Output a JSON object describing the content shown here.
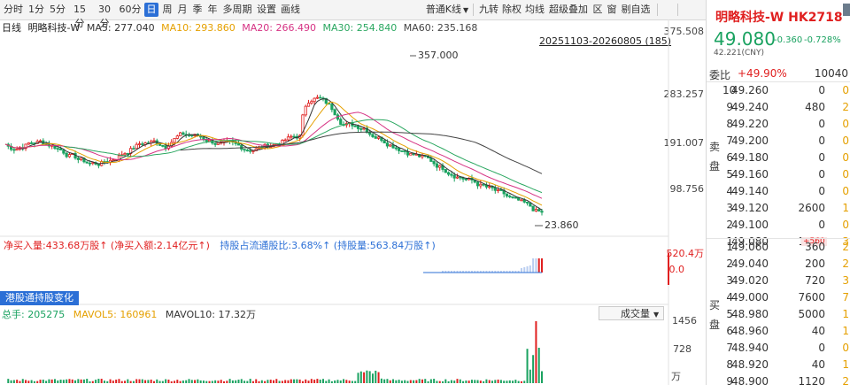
{
  "toolbar": {
    "left_buttons": [
      "分时",
      "1分",
      "5分",
      "15分",
      "30分",
      "60分",
      "日",
      "周",
      "月",
      "季",
      "年",
      "多周期",
      "设置",
      "画线"
    ],
    "active": "日",
    "right_buttons": [
      "普通K线",
      "九转",
      "除权",
      "均线",
      "超级叠加",
      "区",
      "窗",
      "剔自选"
    ]
  },
  "legend": {
    "prefix": "日线",
    "name": "明略科技-W",
    "ma5": "MA5: 277.040",
    "ma10": "MA10: 293.860",
    "ma20": "MA20: 266.490",
    "ma30": "MA30: 254.840",
    "ma60": "MA60: 235.168"
  },
  "range": "20251103-20260805 (185)",
  "price_axis": [
    "375.508",
    "283.257",
    "191.007",
    "98.756"
  ],
  "annotations": {
    "high": "357.000",
    "low": "23.860"
  },
  "flow": {
    "net_buy": "净买入量:433.68万股↑",
    "net_buy_amt": "(净买入额:2.14亿元↑)",
    "hold_ratio": "持股占流通股比:3.68%↑",
    "hold_qty": "(持股量:563.84万股↑)",
    "axis_top": "520.4万",
    "axis_zero": "0.0"
  },
  "tag_button": "港股通持股变化",
  "volume": {
    "total": "总手: 205275",
    "mavol5": "MAVOL5: 160961",
    "mavol10": "MAVOL10: 17.32万",
    "select": "成交量",
    "axis": [
      "1456",
      "728",
      "万"
    ]
  },
  "side": {
    "name": "明略科技-W HK2718",
    "price": "49.080",
    "change": "-0.360",
    "change_pct": "-0.728%",
    "cny": "42.221(CNY)",
    "ratio_label": "委比",
    "ratio_value": "+49.90%",
    "ratio_vol": "10040",
    "sell_label": "卖盘",
    "buy_label": "买盘",
    "asks": [
      {
        "lvl": "10",
        "price": "49.260",
        "vol": "0",
        "cnt": "0"
      },
      {
        "lvl": "9",
        "price": "49.240",
        "vol": "480",
        "cnt": "2"
      },
      {
        "lvl": "8",
        "price": "49.220",
        "vol": "0",
        "cnt": "0"
      },
      {
        "lvl": "7",
        "price": "49.200",
        "vol": "0",
        "cnt": "0"
      },
      {
        "lvl": "6",
        "price": "49.180",
        "vol": "0",
        "cnt": "0"
      },
      {
        "lvl": "5",
        "price": "49.160",
        "vol": "0",
        "cnt": "0"
      },
      {
        "lvl": "4",
        "price": "49.140",
        "vol": "0",
        "cnt": "0"
      },
      {
        "lvl": "3",
        "price": "49.120",
        "vol": "2600",
        "cnt": "1"
      },
      {
        "lvl": "2",
        "price": "49.100",
        "vol": "0",
        "cnt": "0"
      },
      {
        "lvl": "1",
        "price": "49.080",
        "vol": "1960",
        "cnt": "3",
        "delta": "+560"
      }
    ],
    "bids": [
      {
        "lvl": "1",
        "price": "49.060",
        "vol": "360",
        "cnt": "2"
      },
      {
        "lvl": "2",
        "price": "49.040",
        "vol": "200",
        "cnt": "2"
      },
      {
        "lvl": "3",
        "price": "49.020",
        "vol": "720",
        "cnt": "3"
      },
      {
        "lvl": "4",
        "price": "49.000",
        "vol": "7600",
        "cnt": "7"
      },
      {
        "lvl": "5",
        "price": "48.980",
        "vol": "5000",
        "cnt": "1"
      },
      {
        "lvl": "6",
        "price": "48.960",
        "vol": "40",
        "cnt": "1"
      },
      {
        "lvl": "7",
        "price": "48.940",
        "vol": "0",
        "cnt": "0"
      },
      {
        "lvl": "8",
        "price": "48.920",
        "vol": "40",
        "cnt": "1"
      },
      {
        "lvl": "9",
        "price": "48.900",
        "vol": "1120",
        "cnt": "2"
      }
    ]
  },
  "colors": {
    "ma5": "#333333",
    "ma10": "#e5a000",
    "ma20": "#d63384",
    "ma30": "#2aa760",
    "ma60": "#444444",
    "up": "#e02020",
    "down": "#1aa260",
    "accent": "#2b6fd6"
  }
}
